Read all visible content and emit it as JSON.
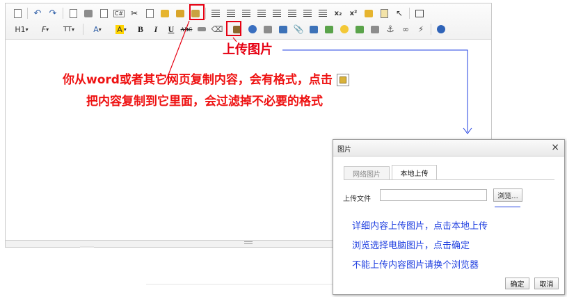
{
  "toolbar": {
    "row1": [
      "source-icon",
      "undo-icon",
      "redo-icon",
      "preview-icon",
      "print-icon",
      "template-icon",
      "code-icon",
      "cut-icon",
      "copy-icon",
      "paste-icon",
      "paste-plain-icon",
      "paste-word-icon",
      "align-left-icon",
      "align-center-icon",
      "align-right-icon",
      "align-justify-icon",
      "ordered-list-icon",
      "unordered-list-icon",
      "indent-icon",
      "outdent-icon",
      "subscript-icon",
      "superscript-icon",
      "clear-format-icon",
      "select-all-icon",
      "pointer-icon",
      "fullscreen-icon"
    ],
    "heading_label": "H1",
    "bold_label": "B",
    "italic_label": "I",
    "underline_label": "U",
    "strike_label": "ABC",
    "font_color_label": "A",
    "highlight_label": "A",
    "font_family_label": "F",
    "font_size_label": "TT"
  },
  "annotations": {
    "upload_label": "上传图片",
    "paste_line1": "你从word或者其它网页复制内容，会有格式，点击",
    "paste_line2": "把内容复制到它里面，会过滤掉不必要的格式",
    "dialog_line1": "详细内容上传图片，点击本地上传",
    "dialog_line2": "浏览选择电脑图片，点击确定",
    "dialog_line3": "不能上传内容图片请换个浏览器"
  },
  "dialog": {
    "title": "图片",
    "close": "×",
    "tabs": [
      {
        "label": "网络图片",
        "active": false
      },
      {
        "label": "本地上传",
        "active": true
      }
    ],
    "file_label": "上传文件",
    "file_value": "",
    "browse_label": "浏览...",
    "ok_label": "确定",
    "cancel_label": "取消"
  },
  "colors": {
    "annotation_red": "#ee1111",
    "annotation_blue": "#1f3fe0",
    "highlight_box": "#e60012"
  }
}
